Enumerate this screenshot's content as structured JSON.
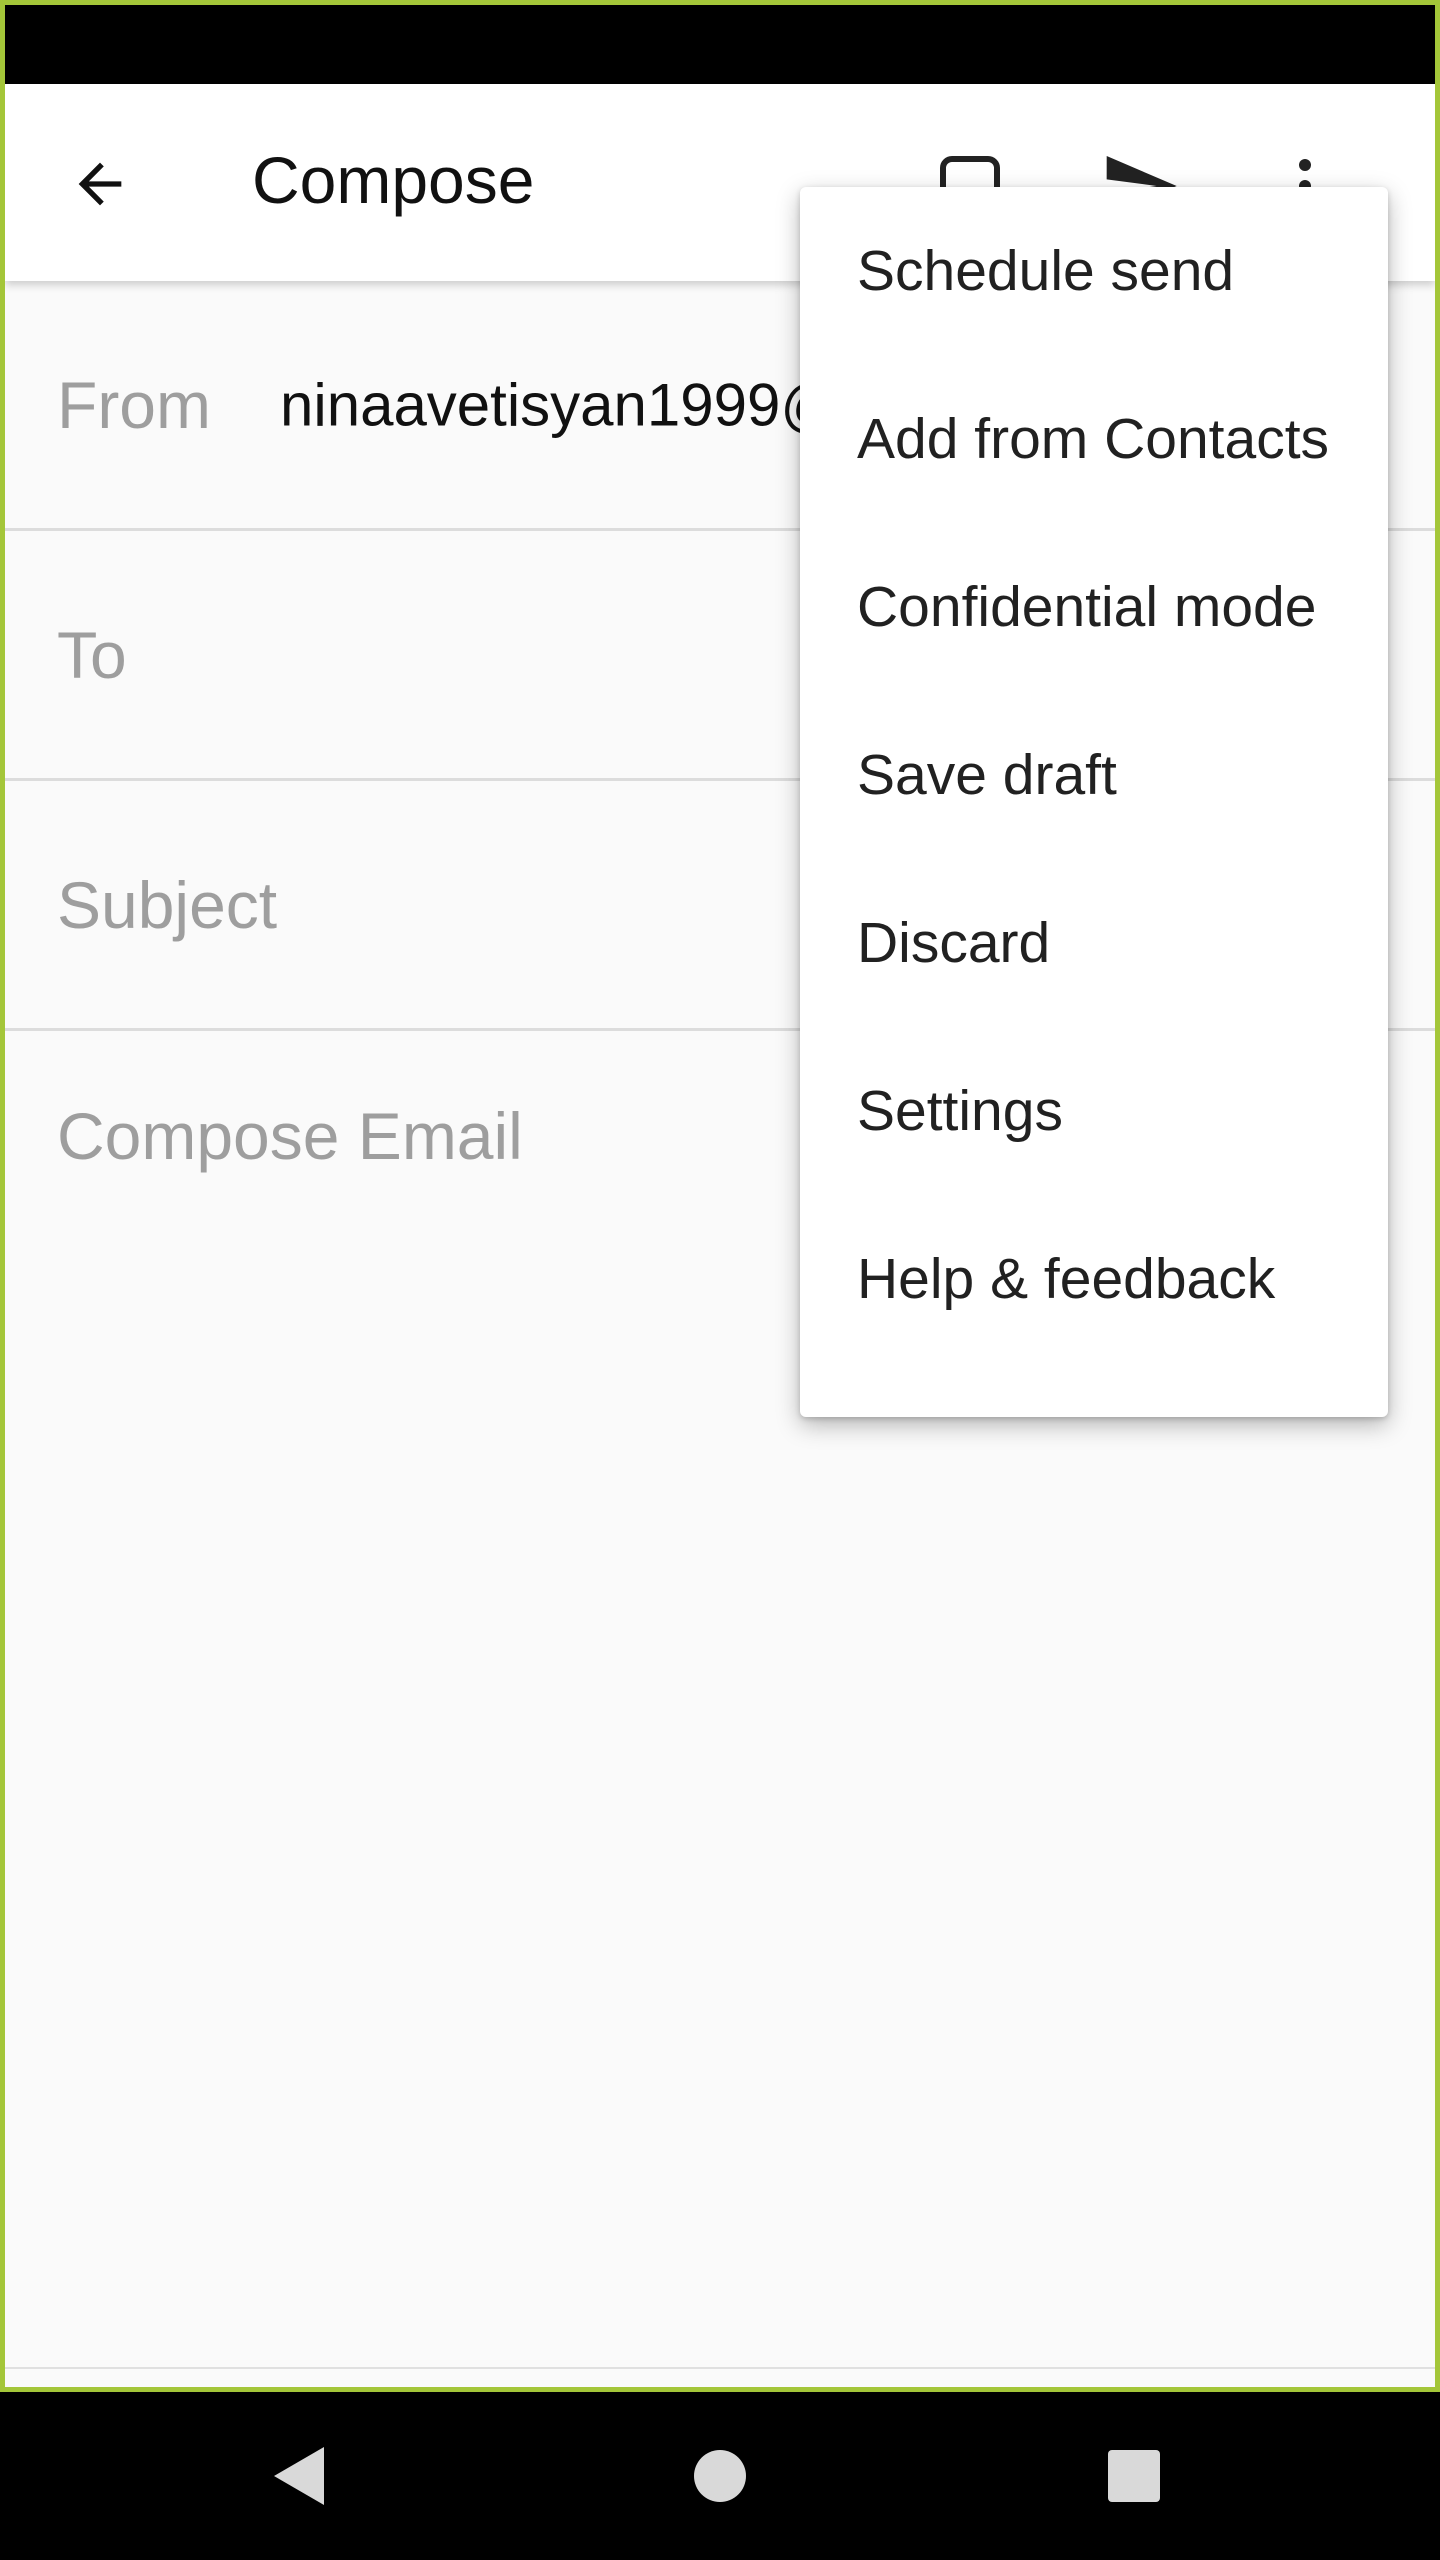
{
  "app_bar": {
    "title": "Compose",
    "icons": [
      "back-arrow-icon",
      "attach-icon",
      "send-icon",
      "more-vert-icon"
    ]
  },
  "form": {
    "from_label": "From",
    "from_value": "ninaavetisyan1999@",
    "to_label": "To",
    "subject_label": "Subject",
    "body_placeholder": "Compose Email"
  },
  "menu": {
    "items": [
      {
        "label": "Schedule send"
      },
      {
        "label": "Add from Contacts"
      },
      {
        "label": "Confidential mode"
      },
      {
        "label": "Save draft"
      },
      {
        "label": "Discard"
      },
      {
        "label": "Settings"
      },
      {
        "label": "Help & feedback"
      }
    ]
  },
  "nav_bar": {
    "icons": [
      "nav-back-icon",
      "nav-home-icon",
      "nav-recents-icon"
    ]
  },
  "colors": {
    "frame_border": "#a4c639",
    "background": "#fafafa",
    "placeholder_text": "#9e9e9e",
    "primary_text": "#111111"
  }
}
